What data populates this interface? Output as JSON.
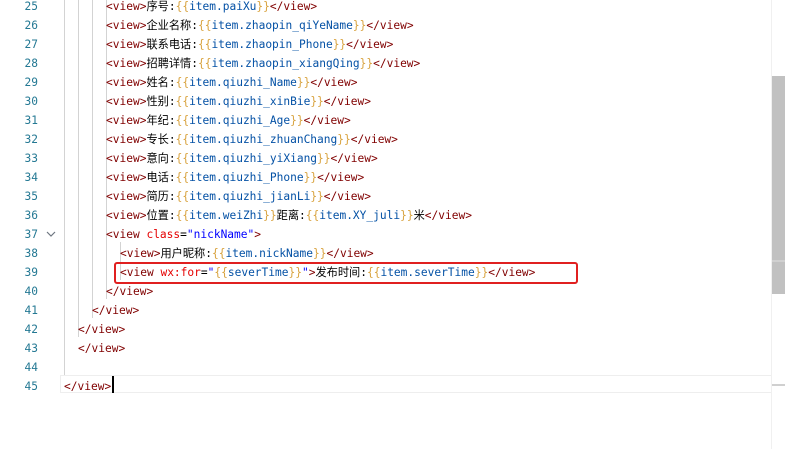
{
  "line_numbers": [
    "25",
    "26",
    "27",
    "28",
    "29",
    "30",
    "31",
    "32",
    "33",
    "34",
    "35",
    "36",
    "37",
    "38",
    "39",
    "40",
    "41",
    "42",
    "43",
    "44",
    "45"
  ],
  "fold_icon": "chevron-down-icon",
  "lines": [
    {
      "indent": 106,
      "parts": [
        {
          "t": "<",
          "c": "br"
        },
        {
          "t": "view",
          "c": "tag"
        },
        {
          "t": ">",
          "c": "br"
        },
        {
          "t": "序号:",
          "c": "txt"
        },
        {
          "t": "{{",
          "c": "mus"
        },
        {
          "t": "item.paiXu",
          "c": "expr"
        },
        {
          "t": "}}",
          "c": "mus"
        },
        {
          "t": "</",
          "c": "br"
        },
        {
          "t": "view",
          "c": "tag"
        },
        {
          "t": ">",
          "c": "br"
        }
      ]
    },
    {
      "indent": 106,
      "parts": [
        {
          "t": "<",
          "c": "br"
        },
        {
          "t": "view",
          "c": "tag"
        },
        {
          "t": ">",
          "c": "br"
        },
        {
          "t": "企业名称:",
          "c": "txt"
        },
        {
          "t": "{{",
          "c": "mus"
        },
        {
          "t": "item.zhaopin_qiYeName",
          "c": "expr"
        },
        {
          "t": "}}",
          "c": "mus"
        },
        {
          "t": "</",
          "c": "br"
        },
        {
          "t": "view",
          "c": "tag"
        },
        {
          "t": ">",
          "c": "br"
        }
      ]
    },
    {
      "indent": 106,
      "parts": [
        {
          "t": "<",
          "c": "br"
        },
        {
          "t": "view",
          "c": "tag"
        },
        {
          "t": ">",
          "c": "br"
        },
        {
          "t": "联系电话:",
          "c": "txt"
        },
        {
          "t": "{{",
          "c": "mus"
        },
        {
          "t": "item.zhaopin_Phone",
          "c": "expr"
        },
        {
          "t": "}}",
          "c": "mus"
        },
        {
          "t": "</",
          "c": "br"
        },
        {
          "t": "view",
          "c": "tag"
        },
        {
          "t": ">",
          "c": "br"
        }
      ]
    },
    {
      "indent": 106,
      "parts": [
        {
          "t": "<",
          "c": "br"
        },
        {
          "t": "view",
          "c": "tag"
        },
        {
          "t": ">",
          "c": "br"
        },
        {
          "t": "招聘详情:",
          "c": "txt"
        },
        {
          "t": "{{",
          "c": "mus"
        },
        {
          "t": "item.zhaopin_xiangQing",
          "c": "expr"
        },
        {
          "t": "}}",
          "c": "mus"
        },
        {
          "t": "</",
          "c": "br"
        },
        {
          "t": "view",
          "c": "tag"
        },
        {
          "t": ">",
          "c": "br"
        }
      ]
    },
    {
      "indent": 106,
      "parts": [
        {
          "t": "<",
          "c": "br"
        },
        {
          "t": "view",
          "c": "tag"
        },
        {
          "t": ">",
          "c": "br"
        },
        {
          "t": "姓名:",
          "c": "txt"
        },
        {
          "t": "{{",
          "c": "mus"
        },
        {
          "t": "item.qiuzhi_Name",
          "c": "expr"
        },
        {
          "t": "}}",
          "c": "mus"
        },
        {
          "t": "</",
          "c": "br"
        },
        {
          "t": "view",
          "c": "tag"
        },
        {
          "t": ">",
          "c": "br"
        }
      ]
    },
    {
      "indent": 106,
      "parts": [
        {
          "t": "<",
          "c": "br"
        },
        {
          "t": "view",
          "c": "tag"
        },
        {
          "t": ">",
          "c": "br"
        },
        {
          "t": "性别:",
          "c": "txt"
        },
        {
          "t": "{{",
          "c": "mus"
        },
        {
          "t": "item.qiuzhi_xinBie",
          "c": "expr"
        },
        {
          "t": "}}",
          "c": "mus"
        },
        {
          "t": "</",
          "c": "br"
        },
        {
          "t": "view",
          "c": "tag"
        },
        {
          "t": ">",
          "c": "br"
        }
      ]
    },
    {
      "indent": 106,
      "parts": [
        {
          "t": "<",
          "c": "br"
        },
        {
          "t": "view",
          "c": "tag"
        },
        {
          "t": ">",
          "c": "br"
        },
        {
          "t": "年纪:",
          "c": "txt"
        },
        {
          "t": "{{",
          "c": "mus"
        },
        {
          "t": "item.qiuzhi_Age",
          "c": "expr"
        },
        {
          "t": "}}",
          "c": "mus"
        },
        {
          "t": "</",
          "c": "br"
        },
        {
          "t": "view",
          "c": "tag"
        },
        {
          "t": ">",
          "c": "br"
        }
      ]
    },
    {
      "indent": 106,
      "parts": [
        {
          "t": "<",
          "c": "br"
        },
        {
          "t": "view",
          "c": "tag"
        },
        {
          "t": ">",
          "c": "br"
        },
        {
          "t": "专长:",
          "c": "txt"
        },
        {
          "t": "{{",
          "c": "mus"
        },
        {
          "t": "item.qiuzhi_zhuanChang",
          "c": "expr"
        },
        {
          "t": "}}",
          "c": "mus"
        },
        {
          "t": "</",
          "c": "br"
        },
        {
          "t": "view",
          "c": "tag"
        },
        {
          "t": ">",
          "c": "br"
        }
      ]
    },
    {
      "indent": 106,
      "parts": [
        {
          "t": "<",
          "c": "br"
        },
        {
          "t": "view",
          "c": "tag"
        },
        {
          "t": ">",
          "c": "br"
        },
        {
          "t": "意向:",
          "c": "txt"
        },
        {
          "t": "{{",
          "c": "mus"
        },
        {
          "t": "item.qiuzhi_yiXiang",
          "c": "expr"
        },
        {
          "t": "}}",
          "c": "mus"
        },
        {
          "t": "</",
          "c": "br"
        },
        {
          "t": "view",
          "c": "tag"
        },
        {
          "t": ">",
          "c": "br"
        }
      ]
    },
    {
      "indent": 106,
      "parts": [
        {
          "t": "<",
          "c": "br"
        },
        {
          "t": "view",
          "c": "tag"
        },
        {
          "t": ">",
          "c": "br"
        },
        {
          "t": "电话:",
          "c": "txt"
        },
        {
          "t": "{{",
          "c": "mus"
        },
        {
          "t": "item.qiuzhi_Phone",
          "c": "expr"
        },
        {
          "t": "}}",
          "c": "mus"
        },
        {
          "t": "</",
          "c": "br"
        },
        {
          "t": "view",
          "c": "tag"
        },
        {
          "t": ">",
          "c": "br"
        }
      ]
    },
    {
      "indent": 106,
      "parts": [
        {
          "t": "<",
          "c": "br"
        },
        {
          "t": "view",
          "c": "tag"
        },
        {
          "t": ">",
          "c": "br"
        },
        {
          "t": "简历:",
          "c": "txt"
        },
        {
          "t": "{{",
          "c": "mus"
        },
        {
          "t": "item.qiuzhi_jianLi",
          "c": "expr"
        },
        {
          "t": "}}",
          "c": "mus"
        },
        {
          "t": "</",
          "c": "br"
        },
        {
          "t": "view",
          "c": "tag"
        },
        {
          "t": ">",
          "c": "br"
        }
      ]
    },
    {
      "indent": 106,
      "parts": [
        {
          "t": "<",
          "c": "br"
        },
        {
          "t": "view",
          "c": "tag"
        },
        {
          "t": ">",
          "c": "br"
        },
        {
          "t": "位置:",
          "c": "txt"
        },
        {
          "t": "{{",
          "c": "mus"
        },
        {
          "t": "item.weiZhi",
          "c": "expr"
        },
        {
          "t": "}}",
          "c": "mus"
        },
        {
          "t": "距离:",
          "c": "txt"
        },
        {
          "t": "{{",
          "c": "mus"
        },
        {
          "t": "item.XY_juli",
          "c": "expr"
        },
        {
          "t": "}}",
          "c": "mus"
        },
        {
          "t": "米",
          "c": "txt"
        },
        {
          "t": "</",
          "c": "br"
        },
        {
          "t": "view",
          "c": "tag"
        },
        {
          "t": ">",
          "c": "br"
        }
      ]
    },
    {
      "indent": 106,
      "parts": [
        {
          "t": "<",
          "c": "br"
        },
        {
          "t": "view",
          "c": "tag"
        },
        {
          "t": " ",
          "c": "txt"
        },
        {
          "t": "class",
          "c": "attr"
        },
        {
          "t": "=",
          "c": "txt"
        },
        {
          "t": "\"nickName\"",
          "c": "str"
        },
        {
          "t": ">",
          "c": "br"
        }
      ]
    },
    {
      "indent": 120,
      "parts": [
        {
          "t": "<",
          "c": "br"
        },
        {
          "t": "view",
          "c": "tag"
        },
        {
          "t": ">",
          "c": "br"
        },
        {
          "t": "用户昵称:",
          "c": "txt"
        },
        {
          "t": "{{",
          "c": "mus"
        },
        {
          "t": "item.nickName",
          "c": "expr"
        },
        {
          "t": "}}",
          "c": "mus"
        },
        {
          "t": "</",
          "c": "br"
        },
        {
          "t": "view",
          "c": "tag"
        },
        {
          "t": ">",
          "c": "br"
        }
      ]
    },
    {
      "indent": 120,
      "parts": [
        {
          "t": "<",
          "c": "br"
        },
        {
          "t": "view",
          "c": "tag"
        },
        {
          "t": " ",
          "c": "txt"
        },
        {
          "t": "wx:for",
          "c": "attr"
        },
        {
          "t": "=",
          "c": "txt"
        },
        {
          "t": "\"",
          "c": "str"
        },
        {
          "t": "{{",
          "c": "mus"
        },
        {
          "t": "severTime",
          "c": "expr"
        },
        {
          "t": "}}",
          "c": "mus"
        },
        {
          "t": "\"",
          "c": "str"
        },
        {
          "t": ">",
          "c": "br"
        },
        {
          "t": "发布时间:",
          "c": "txt"
        },
        {
          "t": "{{",
          "c": "mus"
        },
        {
          "t": "item.severTime",
          "c": "expr"
        },
        {
          "t": "}}",
          "c": "mus"
        },
        {
          "t": "</",
          "c": "br"
        },
        {
          "t": "view",
          "c": "tag"
        },
        {
          "t": ">",
          "c": "br"
        }
      ]
    },
    {
      "indent": 106,
      "parts": [
        {
          "t": "</",
          "c": "br"
        },
        {
          "t": "view",
          "c": "tag"
        },
        {
          "t": ">",
          "c": "br"
        }
      ]
    },
    {
      "indent": 92,
      "parts": [
        {
          "t": "</",
          "c": "br"
        },
        {
          "t": "view",
          "c": "tag"
        },
        {
          "t": ">",
          "c": "br"
        }
      ]
    },
    {
      "indent": 78,
      "parts": [
        {
          "t": "</",
          "c": "br"
        },
        {
          "t": "view",
          "c": "tag"
        },
        {
          "t": ">",
          "c": "br"
        }
      ]
    },
    {
      "indent": 78,
      "parts": [
        {
          "t": "</",
          "c": "br"
        },
        {
          "t": "view",
          "c": "tag"
        },
        {
          "t": ">",
          "c": "br"
        }
      ]
    },
    {
      "indent": 64,
      "parts": []
    },
    {
      "indent": 64,
      "parts": [
        {
          "t": "</",
          "c": "br"
        },
        {
          "t": "view",
          "c": "tag"
        },
        {
          "t": ">",
          "c": "br"
        }
      ]
    }
  ],
  "highlight_color": "#e02020",
  "line_number_color": "#237893"
}
